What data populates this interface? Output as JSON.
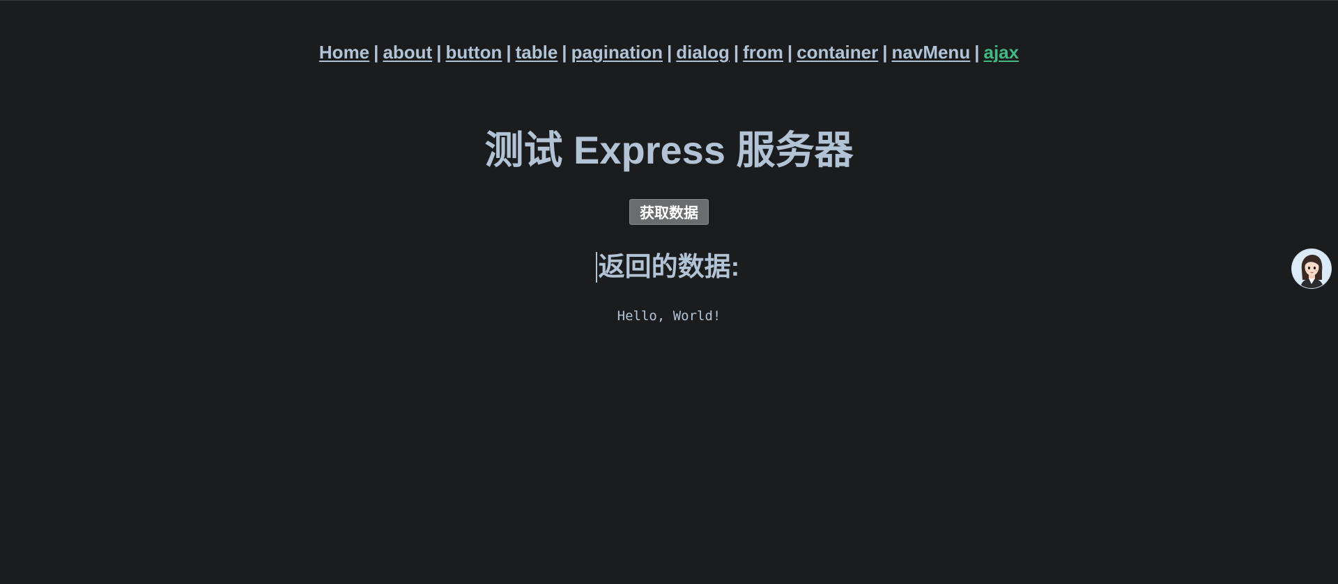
{
  "nav": {
    "links": [
      {
        "label": "Home",
        "active": false
      },
      {
        "label": "about",
        "active": false
      },
      {
        "label": "button",
        "active": false
      },
      {
        "label": "table",
        "active": false
      },
      {
        "label": "pagination",
        "active": false
      },
      {
        "label": "dialog",
        "active": false
      },
      {
        "label": "from",
        "active": false
      },
      {
        "label": "container",
        "active": false
      },
      {
        "label": "navMenu",
        "active": false
      },
      {
        "label": "ajax",
        "active": true
      }
    ],
    "separator": "|"
  },
  "main": {
    "title": "测试 Express 服务器",
    "fetch_button_label": "获取数据",
    "result_heading": "返回的数据:",
    "result_text": "Hello, World!"
  },
  "assistant": {
    "icon": "avatar-icon"
  },
  "colors": {
    "background": "#1b1c1e",
    "text": "#b2c3d6",
    "active_link": "#42b883",
    "button_bg": "#6b6c6e"
  }
}
